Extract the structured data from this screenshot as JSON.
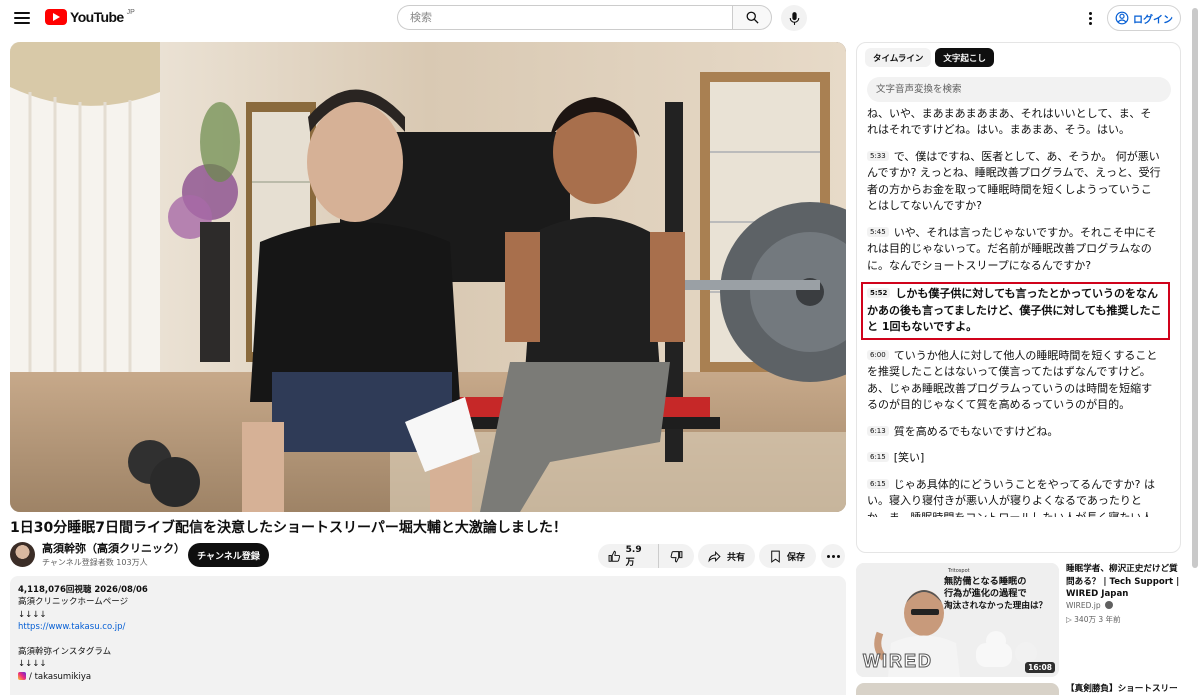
{
  "header": {
    "logo_text": "YouTube",
    "logo_region": "JP",
    "search_placeholder": "検索",
    "login_label": "ログイン"
  },
  "video": {
    "title": "1日30分睡眠7日間ライブ配信を決意したショートスリーパー堀大輔と大激論しました！",
    "channel_name": "高須幹弥（高須クリニック）",
    "channel_subs": "チャンネル登録者数 103万人",
    "subscribe_label": "チャンネル登録",
    "like_count": "5.9万",
    "share_label": "共有",
    "save_label": "保存"
  },
  "description": {
    "meta": "4,118,076回視聴  2026/08/06",
    "lines": [
      "高須クリニックホームページ",
      "↓↓↓↓"
    ],
    "link": "https://www.takasu.co.jp/",
    "lines2": [
      "",
      "高須幹弥インスタグラム",
      "↓↓↓↓"
    ],
    "insta_handle": "/ takasumikiya"
  },
  "transcript": {
    "tabs": [
      "タイムライン",
      "文字起こし"
    ],
    "active_tab": "文字起こし",
    "search_placeholder": "文字音声変換を検索",
    "segments": [
      {
        "time": "",
        "text": "ことなんですけど、まあそれはそうとあれなんですけどね、いや、まあまあまあまあ、それはいいとして、ま、それはそれですけどね。はい。まあまあ、そう。はい。"
      },
      {
        "time": "5:33",
        "text": "で、僕はですね、医者として、あ、そうか。 何が悪いんですか? えっとね、睡眠改善プログラムで、えっと、受行者の方からお金を取って睡眠時間を短くしようっていうことはしてないんですか?"
      },
      {
        "time": "5:45",
        "text": "いや、それは言ったじゃないですか。それこそ中にそれは目的じゃないって。だ名前が睡眠改善プログラムなのに。なんでショートスリープになるんですか?"
      },
      {
        "time": "5:52",
        "text": "しかも僕子供に対しても言ったとかっていうのをなんかあの後も言ってましたけど、僕子供に対しても推奨したこと 1回もないですよ。",
        "current": true
      },
      {
        "time": "6:00",
        "text": "ていうか他人に対して他人の睡眠時間を短くすることを推奨したことはないって僕言ってたはずなんですけど。あ、じゃあ睡眠改善プログラムっていうのは時間を短縮するのが目的じゃなくて質を高めるっていうのが目的。"
      },
      {
        "time": "6:13",
        "text": "質を高めるでもないですけどね。"
      },
      {
        "time": "6:15",
        "text": "[笑い]"
      },
      {
        "time": "6:15",
        "text": "じゃあ具体的にどういうことをやってるんですか? はい。寝入り寝付きが悪い人が寝りよくなるであったりとか、ま、睡眠時間をコントロールしたい人が長く寝たい人"
      }
    ]
  },
  "recommended": [
    {
      "title": "睡眠学者、柳沢正史だけど質問ある？ | Tech Support | WIRED Japan",
      "channel": "WIRED.jp",
      "stats": "▷ 340万  3 年前",
      "duration": "16:08",
      "thumb_caption": [
        "無防備となる睡眠の",
        "行為が進化の過程で",
        "淘汰されなかった理由は？"
      ],
      "thumb_brand": "WIRED",
      "thumb_source": "Tritospot"
    },
    {
      "title": "【真剣勝負】ショートスリー",
      "channel": "",
      "stats": "",
      "duration": ""
    }
  ]
}
